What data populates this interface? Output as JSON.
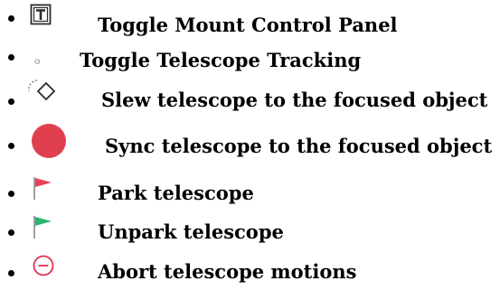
{
  "list": {
    "items": [
      {
        "icon": "toggle-mount-panel-icon",
        "label": "Toggle Mount Control Panel"
      },
      {
        "icon": "tracking-icon",
        "label": "Toggle Telescope Tracking"
      },
      {
        "icon": "slew-icon",
        "label": "Slew telescope to the focused object"
      },
      {
        "icon": "sync-icon",
        "label": "Sync telescope to the focused object"
      },
      {
        "icon": "park-flag-icon",
        "label": "Park telescope"
      },
      {
        "icon": "unpark-flag-icon",
        "label": "Unpark telescope"
      },
      {
        "icon": "abort-icon",
        "label": "Abort telescope motions"
      }
    ]
  },
  "colors": {
    "sync": "#e0404e",
    "park": "#e8405a",
    "unpark": "#2bb56e",
    "abort": "#e03050",
    "icon_stroke": "#2b2b2b"
  }
}
